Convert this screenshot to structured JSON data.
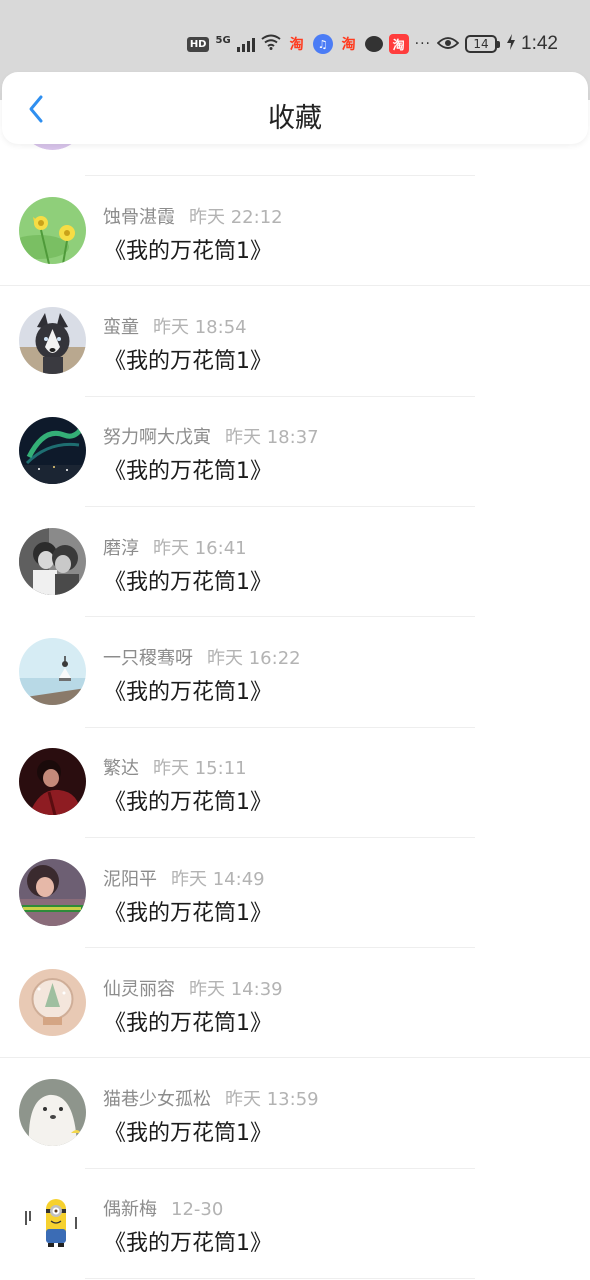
{
  "status_bar": {
    "hd": "HD",
    "network": "5G",
    "app1": "淘",
    "app2": "♫",
    "app3": "淘",
    "app4": "淘",
    "more": "···",
    "battery": "14",
    "time": "1:42"
  },
  "header": {
    "title": "收藏"
  },
  "items": [
    {
      "username": "蚀骨湛霞",
      "time": "昨天 22:12",
      "title": "《我的万花筒1》",
      "avatar": "yellow-flowers-avatar"
    },
    {
      "username": "蛮童",
      "time": "昨天 18:54",
      "title": "《我的万花筒1》",
      "avatar": "husky-dog-avatar"
    },
    {
      "username": "努力啊大戊寅",
      "time": "昨天 18:37",
      "title": "《我的万花筒1》",
      "avatar": "aurora-night-avatar"
    },
    {
      "username": "磨淳",
      "time": "昨天 16:41",
      "title": "《我的万花筒1》",
      "avatar": "couple-photo-avatar"
    },
    {
      "username": "一只稷骞呀",
      "time": "昨天 16:22",
      "title": "《我的万花筒1》",
      "avatar": "yoga-sea-avatar"
    },
    {
      "username": "繁达",
      "time": "昨天 15:11",
      "title": "《我的万花筒1》",
      "avatar": "dark-red-portrait-avatar"
    },
    {
      "username": "泥阳平",
      "time": "昨天 14:49",
      "title": "《我的万花筒1》",
      "avatar": "woman-portrait-avatar"
    },
    {
      "username": "仙灵丽容",
      "time": "昨天 14:39",
      "title": "《我的万花筒1》",
      "avatar": "snow-globe-avatar"
    },
    {
      "username": "猫巷少女孤松",
      "time": "昨天 13:59",
      "title": "《我的万花筒1》",
      "avatar": "white-bear-avatar"
    },
    {
      "username": "偶新梅",
      "time": "12-30",
      "title": "《我的万花筒1》",
      "avatar": "minion-avatar"
    }
  ]
}
